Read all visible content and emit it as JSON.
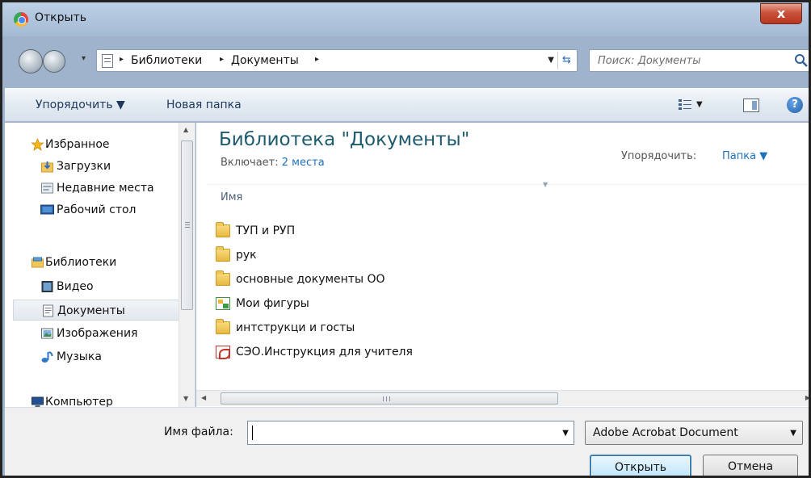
{
  "window": {
    "title": "Открыть",
    "close_label": "x"
  },
  "address": {
    "crumbs": [
      "Библиотеки",
      "Документы"
    ],
    "separator": "▸",
    "search_placeholder": "Поиск: Документы"
  },
  "toolbar": {
    "organize": "Упорядочить ▼",
    "new_folder": "Новая папка",
    "help": "?"
  },
  "nav": {
    "items": [
      {
        "label": "Избранное",
        "icon": "star-icon"
      },
      {
        "label": "Загрузки",
        "icon": "downloads-icon"
      },
      {
        "label": "Недавние места",
        "icon": "recent-places-icon"
      },
      {
        "label": "Рабочий стол",
        "icon": "desktop-icon"
      },
      {
        "label": "Библиотеки",
        "icon": "libraries-icon"
      },
      {
        "label": "Видео",
        "icon": "video-icon"
      },
      {
        "label": "Документы",
        "icon": "documents-icon",
        "selected": true
      },
      {
        "label": "Изображения",
        "icon": "pictures-icon"
      },
      {
        "label": "Музыка",
        "icon": "music-icon"
      },
      {
        "label": "Компьютер",
        "icon": "computer-icon"
      }
    ]
  },
  "content": {
    "title": "Библиотека \"Документы\"",
    "includes_label": "Включает:",
    "includes_link": "2 места",
    "arrange_label": "Упорядочить:",
    "arrange_value": "Папка ▼",
    "column_name": "Имя",
    "files": [
      {
        "name": "ТУП и РУП",
        "type": "folder"
      },
      {
        "name": "рук",
        "type": "folder"
      },
      {
        "name": "основные документы ОО",
        "type": "folder"
      },
      {
        "name": "Мои фигуры",
        "type": "special-folder"
      },
      {
        "name": "интструкци и госты",
        "type": "folder"
      },
      {
        "name": "СЭО.Инструкция для учителя",
        "type": "pdf"
      }
    ]
  },
  "bottom": {
    "filename_label": "Имя файла:",
    "filename_value": "",
    "filetype": "Adobe Acrobat Document",
    "open_button": "Открыть",
    "cancel_button": "Отмена"
  },
  "colors": {
    "accent": "#1f6fbf",
    "title_blue": "#1e5b6f",
    "chrome": "#9fb4cc"
  }
}
